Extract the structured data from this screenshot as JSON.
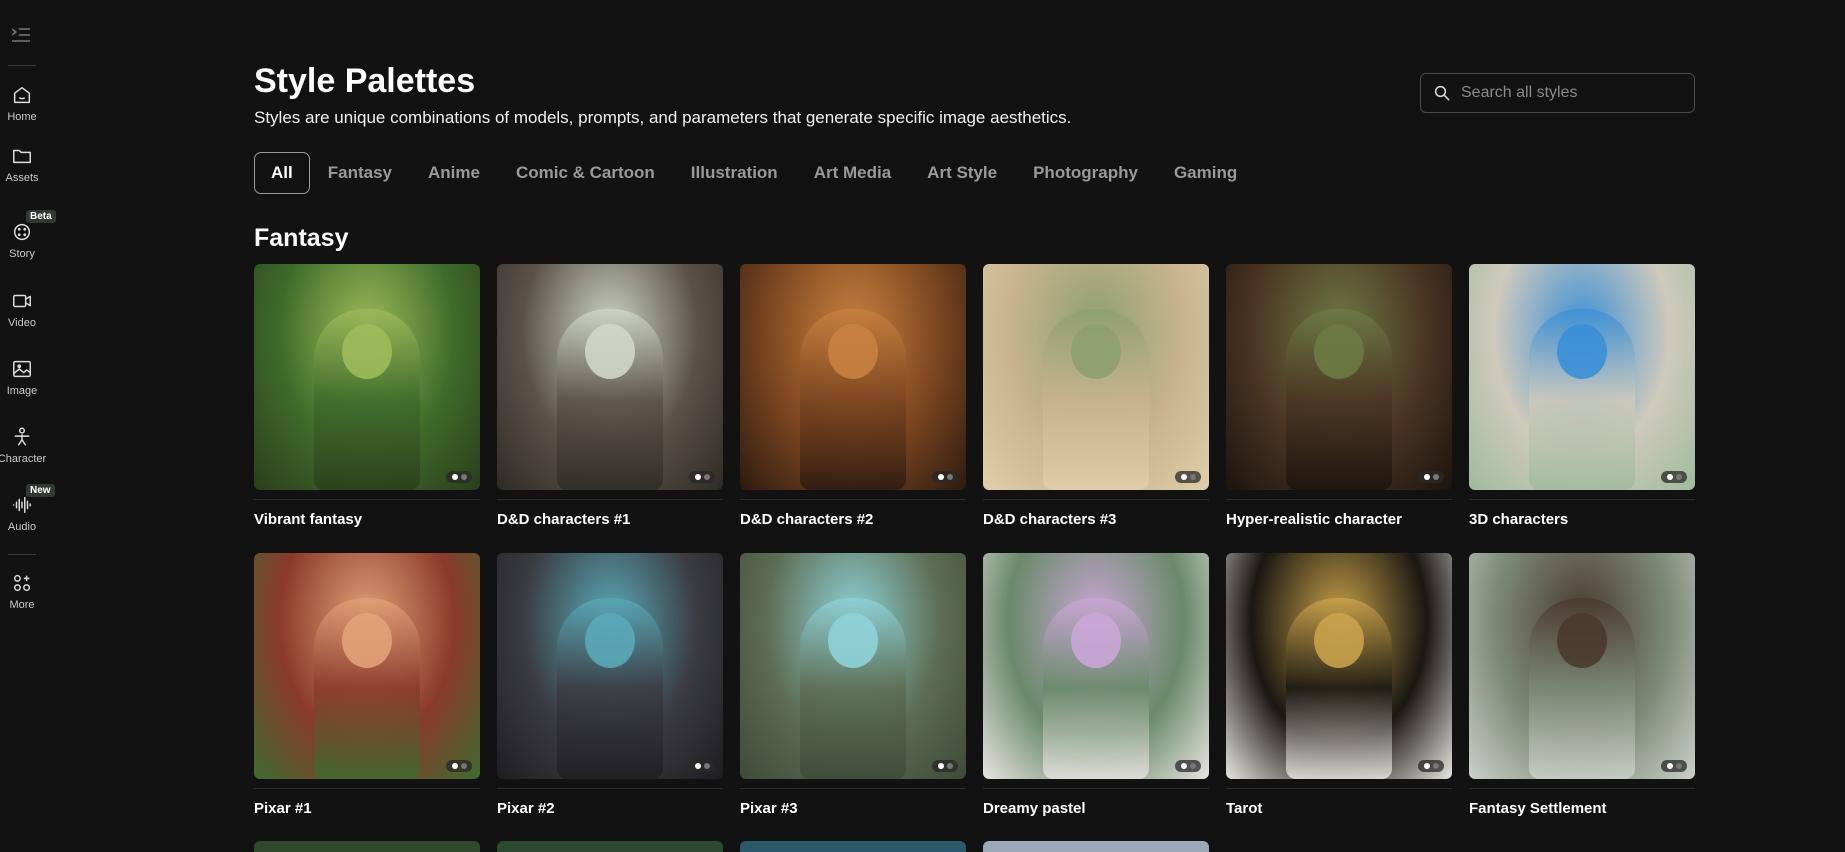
{
  "sidebar": {
    "items": [
      {
        "label": "Home",
        "icon": "home-icon"
      },
      {
        "label": "Assets",
        "icon": "folder-icon"
      },
      {
        "label": "Story",
        "icon": "film-reel-icon",
        "badge": "Beta"
      },
      {
        "label": "Video",
        "icon": "video-camera-icon"
      },
      {
        "label": "Image",
        "icon": "image-icon"
      },
      {
        "label": "Character",
        "icon": "character-icon"
      },
      {
        "label": "Audio",
        "icon": "audio-wave-icon",
        "badge": "New"
      },
      {
        "label": "More",
        "icon": "grid-more-icon"
      }
    ]
  },
  "header": {
    "title": "Style Palettes",
    "subtitle": "Styles are unique combinations of models, prompts, and parameters that generate specific image aesthetics."
  },
  "search": {
    "placeholder": "Search all styles"
  },
  "tabs": [
    {
      "label": "All",
      "active": true
    },
    {
      "label": "Fantasy"
    },
    {
      "label": "Anime"
    },
    {
      "label": "Comic & Cartoon"
    },
    {
      "label": "Illustration"
    },
    {
      "label": "Art Media"
    },
    {
      "label": "Art Style"
    },
    {
      "label": "Photography"
    },
    {
      "label": "Gaming"
    }
  ],
  "section": {
    "title": "Fantasy"
  },
  "cards": [
    {
      "title": "Vibrant fantasy",
      "colors": [
        "#3f6b2a",
        "#9dbb5a",
        "#2a3e1c"
      ]
    },
    {
      "title": "D&D characters #1",
      "colors": [
        "#5a5249",
        "#cfd7c9",
        "#2e2a25"
      ]
    },
    {
      "title": "D&D characters #2",
      "colors": [
        "#7a4520",
        "#c8813f",
        "#2d1a10"
      ]
    },
    {
      "title": "D&D characters #3",
      "colors": [
        "#c8b48e",
        "#8ea070",
        "#e0cfa9"
      ]
    },
    {
      "title": "Hyper-realistic character",
      "colors": [
        "#4a3422",
        "#6d7a45",
        "#1c140e"
      ]
    },
    {
      "title": "3D characters",
      "colors": [
        "#cfcabc",
        "#3b8fd6",
        "#9fbb9c"
      ]
    },
    {
      "title": "Pixar #1",
      "colors": [
        "#8a3a2a",
        "#e2a278",
        "#3e6b30"
      ]
    },
    {
      "title": "Pixar #2",
      "colors": [
        "#3a3b40",
        "#5aa9b8",
        "#1e1d22"
      ]
    },
    {
      "title": "Pixar #3",
      "colors": [
        "#5d6c52",
        "#8ed2d8",
        "#3e4a38"
      ]
    },
    {
      "title": "Dreamy pastel",
      "colors": [
        "#6a8a6a",
        "#c9a6d6",
        "#e8e4e2"
      ]
    },
    {
      "title": "Tarot",
      "colors": [
        "#1a1712",
        "#c9a24a",
        "#e8e6e0"
      ]
    },
    {
      "title": "Fantasy Settlement",
      "colors": [
        "#7d8a78",
        "#4a3a2e",
        "#cbd1c9"
      ]
    }
  ],
  "row3_colors": [
    "#2f4a2a",
    "#2c4a30",
    "#2a5a6a",
    "#9aa8b8"
  ]
}
